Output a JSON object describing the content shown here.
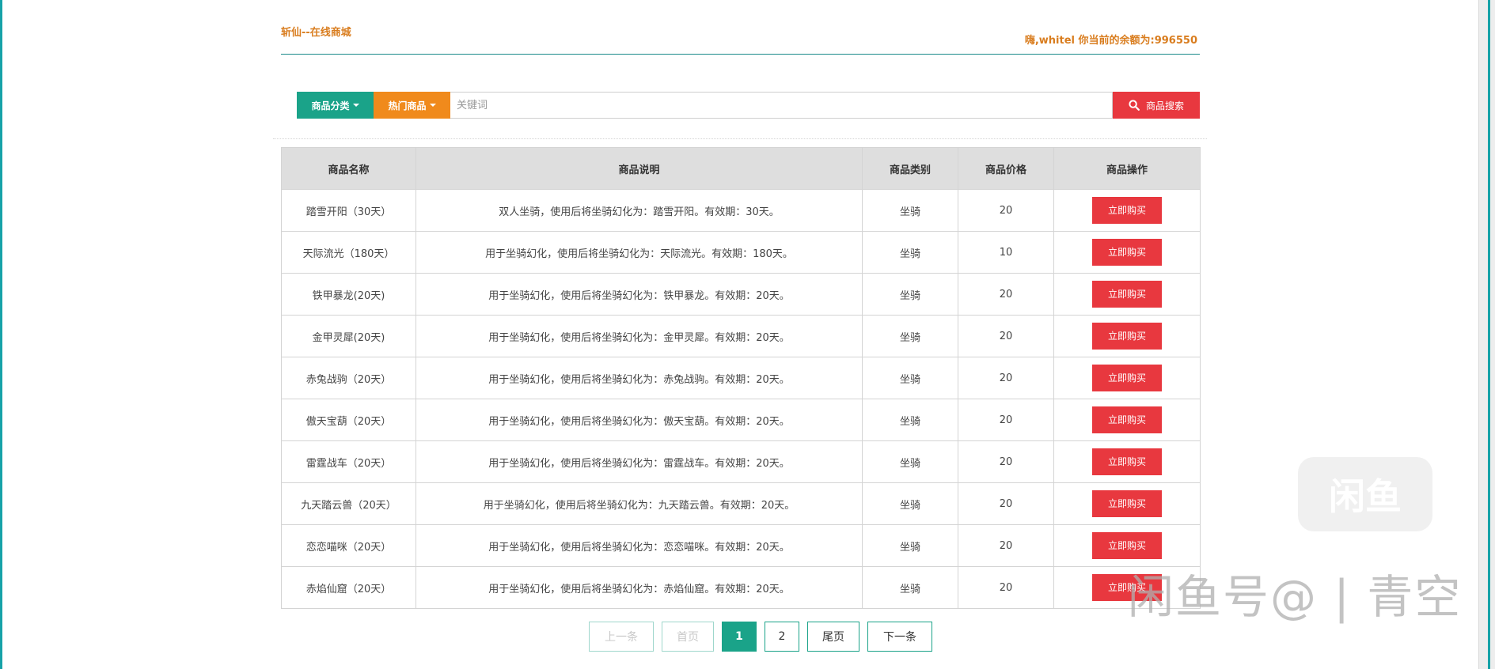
{
  "header": {
    "site_title": "斩仙--在线商城",
    "welcome": "嗨,whitel 你当前的余额为:996550"
  },
  "search": {
    "category_label": "商品分类",
    "hot_label": "热门商品",
    "placeholder": "关键词",
    "search_label": "商品搜索"
  },
  "table": {
    "headers": [
      "商品名称",
      "商品说明",
      "商品类别",
      "商品价格",
      "商品操作"
    ],
    "buy_label": "立即购买",
    "rows": [
      {
        "name": "踏雪开阳（30天）",
        "desc": "双人坐骑，使用后将坐骑幻化为：踏雪开阳。有效期：30天。",
        "category": "坐骑",
        "price": "20"
      },
      {
        "name": "天际流光（180天）",
        "desc": "用于坐骑幻化，使用后将坐骑幻化为：天际流光。有效期：180天。",
        "category": "坐骑",
        "price": "10"
      },
      {
        "name": "铁甲暴龙(20天)",
        "desc": "用于坐骑幻化，使用后将坐骑幻化为：铁甲暴龙。有效期：20天。",
        "category": "坐骑",
        "price": "20"
      },
      {
        "name": "金甲灵犀(20天)",
        "desc": "用于坐骑幻化，使用后将坐骑幻化为：金甲灵犀。有效期：20天。",
        "category": "坐骑",
        "price": "20"
      },
      {
        "name": "赤兔战驹（20天）",
        "desc": "用于坐骑幻化，使用后将坐骑幻化为：赤兔战驹。有效期：20天。",
        "category": "坐骑",
        "price": "20"
      },
      {
        "name": "傲天宝葫（20天）",
        "desc": "用于坐骑幻化，使用后将坐骑幻化为：傲天宝葫。有效期：20天。",
        "category": "坐骑",
        "price": "20"
      },
      {
        "name": "雷霆战车（20天）",
        "desc": "用于坐骑幻化，使用后将坐骑幻化为：雷霆战车。有效期：20天。",
        "category": "坐骑",
        "price": "20"
      },
      {
        "name": "九天踏云兽（20天）",
        "desc": "用于坐骑幻化，使用后将坐骑幻化为：九天踏云兽。有效期：20天。",
        "category": "坐骑",
        "price": "20"
      },
      {
        "name": "恋恋喵咪（20天）",
        "desc": "用于坐骑幻化，使用后将坐骑幻化为：恋恋喵咪。有效期：20天。",
        "category": "坐骑",
        "price": "20"
      },
      {
        "name": "赤焰仙窟（20天）",
        "desc": "用于坐骑幻化，使用后将坐骑幻化为：赤焰仙窟。有效期：20天。",
        "category": "坐骑",
        "price": "20"
      }
    ]
  },
  "pagination": {
    "prev": "上一条",
    "first": "首页",
    "page1": "1",
    "page2": "2",
    "last": "尾页",
    "next": "下一条"
  },
  "watermark": {
    "logo": "闲鱼",
    "text": "闲鱼号@ | 青空"
  },
  "colors": {
    "accent_teal": "#1aa389",
    "accent_orange": "#f08a1c",
    "danger_red": "#e8383f",
    "title_orange": "#d97d1f"
  }
}
